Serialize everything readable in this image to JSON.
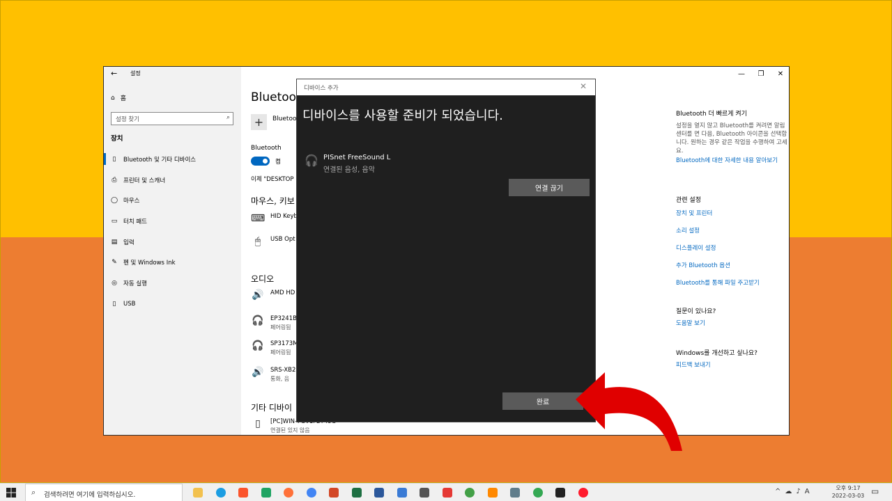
{
  "settings_window": {
    "title": "설정",
    "back_glyph": "←",
    "controls": [
      "—",
      "❐",
      "✕"
    ],
    "sidebar": {
      "home": "홈",
      "search_placeholder": "설정 찾기",
      "section": "장치",
      "items": [
        {
          "label": "Bluetooth 및 기타 디바이스",
          "icon": "bluetooth-devices-icon",
          "active": true
        },
        {
          "label": "프린터 및 스캐너",
          "icon": "printer-icon"
        },
        {
          "label": "마우스",
          "icon": "mouse-icon"
        },
        {
          "label": "터치 패드",
          "icon": "touchpad-icon"
        },
        {
          "label": "입력",
          "icon": "keyboard-icon"
        },
        {
          "label": "펜 및 Windows Ink",
          "icon": "pen-icon"
        },
        {
          "label": "자동 실행",
          "icon": "autoplay-icon"
        },
        {
          "label": "USB",
          "icon": "usb-icon"
        }
      ]
    },
    "main": {
      "title": "Bluetoot",
      "add_label": "Bluetoo",
      "bluetooth_label": "Bluetooth",
      "toggle_label": "켬",
      "now_text": "이제 \"DESKTOP",
      "mouse_heading": "마우스, 키보",
      "mouse_devices": [
        {
          "name": "HID Keyb",
          "sub": ""
        },
        {
          "name": "USB Opt",
          "sub": ""
        }
      ],
      "audio_heading": "오디오",
      "audio_devices": [
        {
          "name": "AMD HD",
          "sub": ""
        },
        {
          "name": "EP3241B",
          "sub": "페어링됨"
        },
        {
          "name": "SP3173M",
          "sub": "페어링됨"
        },
        {
          "name": "SRS-XB2",
          "sub": "통화, 음"
        }
      ],
      "other_heading": "기타 디바이",
      "other_devices": [
        {
          "name": "[PC]WIN-7GV1F2T43G",
          "sub": "연결된 있지 않음"
        }
      ]
    },
    "right_panel": {
      "quick_head": "Bluetooth 더 빠르게 켜기",
      "quick_text": "설정을 열지 않고 Bluetooth를 켜려면 알림 센터를 면 다음, Bluetooth 아이콘을 선택합니다. 원하는 경우 같은 작업을 수행하여 고세요.",
      "quick_link": "Bluetooth에 대한 자세한 내용 알아보기",
      "related_head": "관련 설정",
      "related_links": [
        "장치 및 프린터",
        "소리 설정",
        "디스플레이 설정",
        "추가 Bluetooth 옵션",
        "Bluetooth를 통해 파일 주고받기"
      ],
      "question_head": "질문이 있나요?",
      "question_link": "도움말 보기",
      "improve_head": "Windows를 개선하고 싶나요?",
      "improve_link": "피드백 보내기"
    }
  },
  "dialog": {
    "title": "디바이스 추가",
    "heading": "디바이스를 사용할 준비가 되었습니다.",
    "device_name": "PISnet FreeSound L",
    "device_status": "연결된 음성, 음악",
    "disconnect_label": "연결 끊기",
    "done_label": "완료"
  },
  "taskbar": {
    "search_placeholder": "검색하려면 여기에 입력하십시오.",
    "apps": [
      {
        "name": "file-explorer-icon",
        "color": "#f2c14e"
      },
      {
        "name": "edge-icon",
        "color": "#1b9de2",
        "round": true
      },
      {
        "name": "brave-icon",
        "color": "#fb542b"
      },
      {
        "name": "app-green-icon",
        "color": "#1fa463"
      },
      {
        "name": "firefox-icon",
        "color": "#ff7139",
        "round": true
      },
      {
        "name": "chrome-icon",
        "color": "#4285f4",
        "round": true
      },
      {
        "name": "powerpoint-icon",
        "color": "#d24726"
      },
      {
        "name": "excel-icon",
        "color": "#1d6f42"
      },
      {
        "name": "word-icon",
        "color": "#2b579a"
      },
      {
        "name": "remote-desktop-icon",
        "color": "#3a7bd5"
      },
      {
        "name": "tool-icon",
        "color": "#555555"
      },
      {
        "name": "app-se-icon",
        "color": "#e53935"
      },
      {
        "name": "app-download-icon",
        "color": "#43a047",
        "round": true
      },
      {
        "name": "vlc-icon",
        "color": "#ff8800"
      },
      {
        "name": "calculator-icon",
        "color": "#607d8b"
      },
      {
        "name": "chrome-alt-icon",
        "color": "#34a853",
        "round": true
      },
      {
        "name": "sticky-notes-icon",
        "color": "#222222"
      },
      {
        "name": "opera-icon",
        "color": "#ff1b2d",
        "round": true
      }
    ],
    "tray": [
      "^",
      "☁",
      "♪",
      "A"
    ],
    "time": "오후 9:17",
    "date": "2022-03-03"
  },
  "colors": {
    "top_band": "#FFC000",
    "bottom_band": "#ED7D31",
    "accent": "#0067c0",
    "dialog_bg": "#1f1f1f",
    "arrow": "#e00000"
  }
}
